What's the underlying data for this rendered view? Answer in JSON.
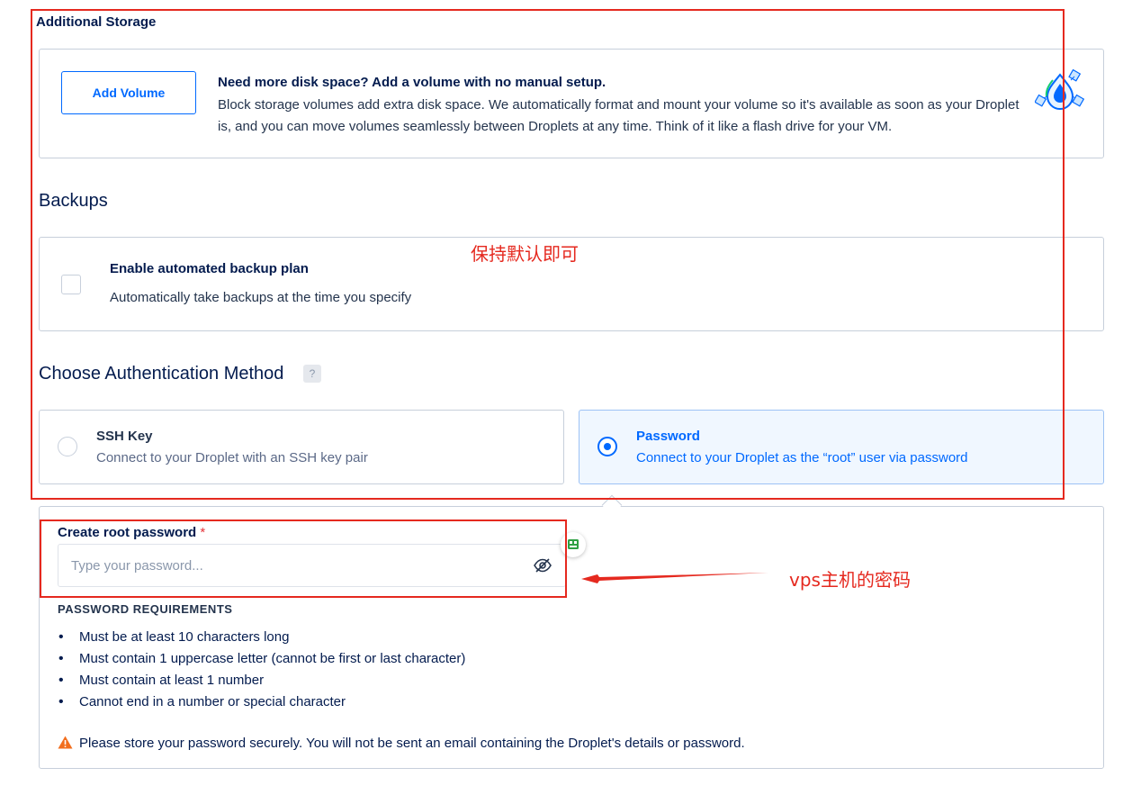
{
  "storage": {
    "title": "Additional Storage",
    "add_volume_label": "Add Volume",
    "heading": "Need more disk space? Add a volume with no manual setup.",
    "description": "Block storage volumes add extra disk space. We automatically format and mount your volume so it's available as soon as your Droplet is, and you can move volumes seamlessly between Droplets at any time. Think of it like a flash drive for your VM.",
    "icon": "block-storage-icon"
  },
  "backups": {
    "title": "Backups",
    "checkbox_label": "Enable automated backup plan",
    "checkbox_desc": "Automatically take backups at the time you specify",
    "checked": false
  },
  "auth": {
    "title": "Choose Authentication Method",
    "help_label": "?",
    "options": [
      {
        "label": "SSH Key",
        "desc": "Connect to your Droplet with an SSH key pair",
        "selected": false
      },
      {
        "label": "Password",
        "desc": "Connect to your Droplet as the “root” user via password",
        "selected": true
      }
    ]
  },
  "password": {
    "field_label": "Create root password",
    "required_mark": "*",
    "placeholder": "Type your password...",
    "requirements_title": "PASSWORD REQUIREMENTS",
    "requirements": [
      "Must be at least 10 characters long",
      "Must contain 1 uppercase letter (cannot be first or last character)",
      "Must contain at least 1 number",
      "Cannot end in a number or special character"
    ],
    "warning": "Please store your password securely. You will not be sent an email containing the Droplet's details or password."
  },
  "annotations": {
    "note_keep_default": "保持默认即可",
    "note_vps_password": "vps主机的密码",
    "color": "#e5291f"
  },
  "colors": {
    "accent": "#0069ff",
    "text": "#031b4e",
    "border": "#c7cfdb",
    "warning": "#f26e1d"
  }
}
